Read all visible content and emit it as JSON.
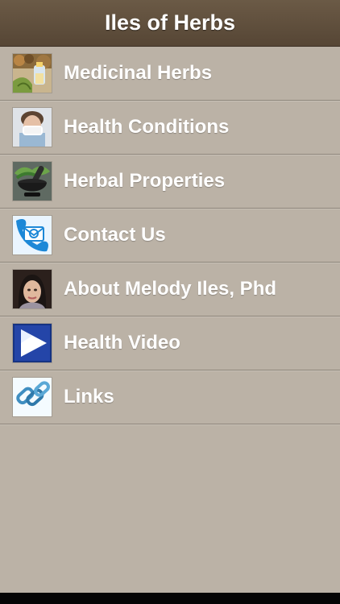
{
  "header": {
    "title": "Iles of Herbs"
  },
  "menu": {
    "items": [
      {
        "label": "Medicinal Herbs",
        "icon": "herbs-and-oil-bottle-icon"
      },
      {
        "label": "Health Conditions",
        "icon": "sick-person-icon"
      },
      {
        "label": "Herbal Properties",
        "icon": "mortar-and-pestle-icon"
      },
      {
        "label": "Contact Us",
        "icon": "phone-email-icon"
      },
      {
        "label": "About Melody Iles, Phd",
        "icon": "portrait-photo-icon"
      },
      {
        "label": "Health Video",
        "icon": "play-icon"
      },
      {
        "label": "Links",
        "icon": "chain-link-icon"
      }
    ]
  },
  "colors": {
    "background": "#bbb2a6",
    "header": "#5c4b39",
    "divider": "#8f877c",
    "text": "#ffffff"
  }
}
